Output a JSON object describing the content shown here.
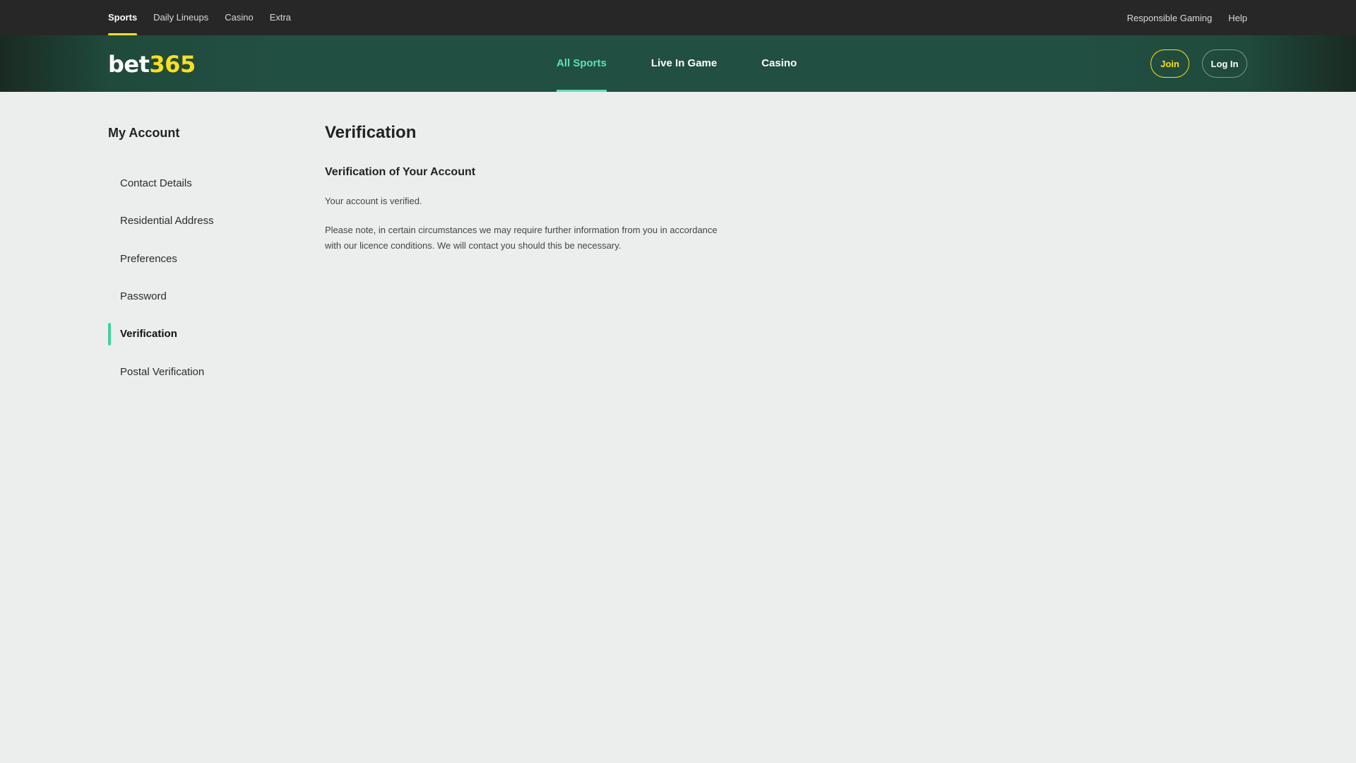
{
  "topbar": {
    "left_links": [
      "Sports",
      "Daily Lineups",
      "Casino",
      "Extra"
    ],
    "active_index": 0,
    "right_links": [
      "Responsible Gaming",
      "Help"
    ]
  },
  "header": {
    "logo_text_1": "bet",
    "logo_text_2": "365",
    "nav": [
      "All Sports",
      "Live In Game",
      "Casino"
    ],
    "active_nav": "All Sports",
    "join_label": "Join",
    "login_label": "Log In"
  },
  "sidebar": {
    "title": "My Account",
    "items": [
      "Contact Details",
      "Residential Address",
      "Preferences",
      "Password",
      "Verification",
      "Postal Verification"
    ],
    "active_item": "Verification"
  },
  "main": {
    "title": "Verification",
    "subtitle": "Verification of Your Account",
    "status_text": "Your account is verified.",
    "note_text": "Please note, in certain circumstances we may require further information from you in accordance with our licence conditions. We will contact you should this be necessary."
  },
  "colors": {
    "accent_yellow": "#ffdf1b",
    "accent_green": "#3fd1a0",
    "header_green": "#214f41",
    "topbar_bg": "#272727",
    "page_bg": "#eceeed"
  }
}
